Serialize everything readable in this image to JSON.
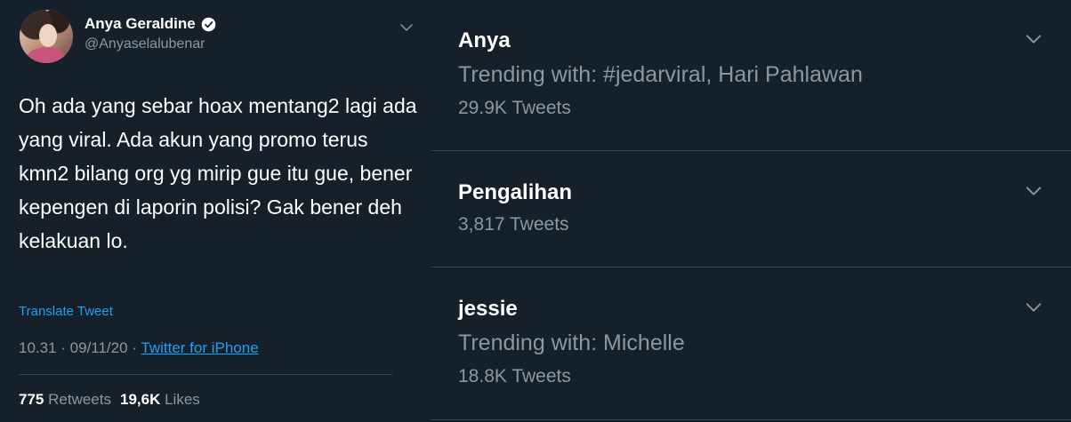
{
  "tweet": {
    "display_name": "Anya Geraldine",
    "handle": "@Anyaselalubenar",
    "text": "Oh ada yang sebar hoax mentang2 lagi ada yang viral. Ada akun yang promo terus kmn2 bilang org yg mirip gue itu gue, bener kepengen di laporin polisi? Gak bener deh kelakuan lo.",
    "translate_label": "Translate Tweet",
    "time": "10.31",
    "separator": " · ",
    "date": "09/11/20",
    "date_sep": " · ",
    "source": "Twitter for iPhone",
    "retweets_count": "775",
    "retweets_label": "Retweets",
    "likes_count": "19,6K",
    "likes_label": "Likes",
    "avatar_icon": "profile-photo",
    "verified_icon": "verified-badge-icon",
    "caret_icon": "chevron-down-icon"
  },
  "trends": [
    {
      "title": "Anya",
      "context": "Trending with: #jedarviral, Hari Pahlawan",
      "count": "29.9K Tweets"
    },
    {
      "title": "Pengalihan",
      "context": "",
      "count": "3,817 Tweets"
    },
    {
      "title": "jessie",
      "context": "Trending with: Michelle",
      "count": "18.8K Tweets"
    }
  ],
  "colors": {
    "background": "#15202b",
    "primary_text": "#ffffff",
    "secondary_text": "#8899a6",
    "link": "#1da1f2",
    "divider": "#38444d"
  }
}
